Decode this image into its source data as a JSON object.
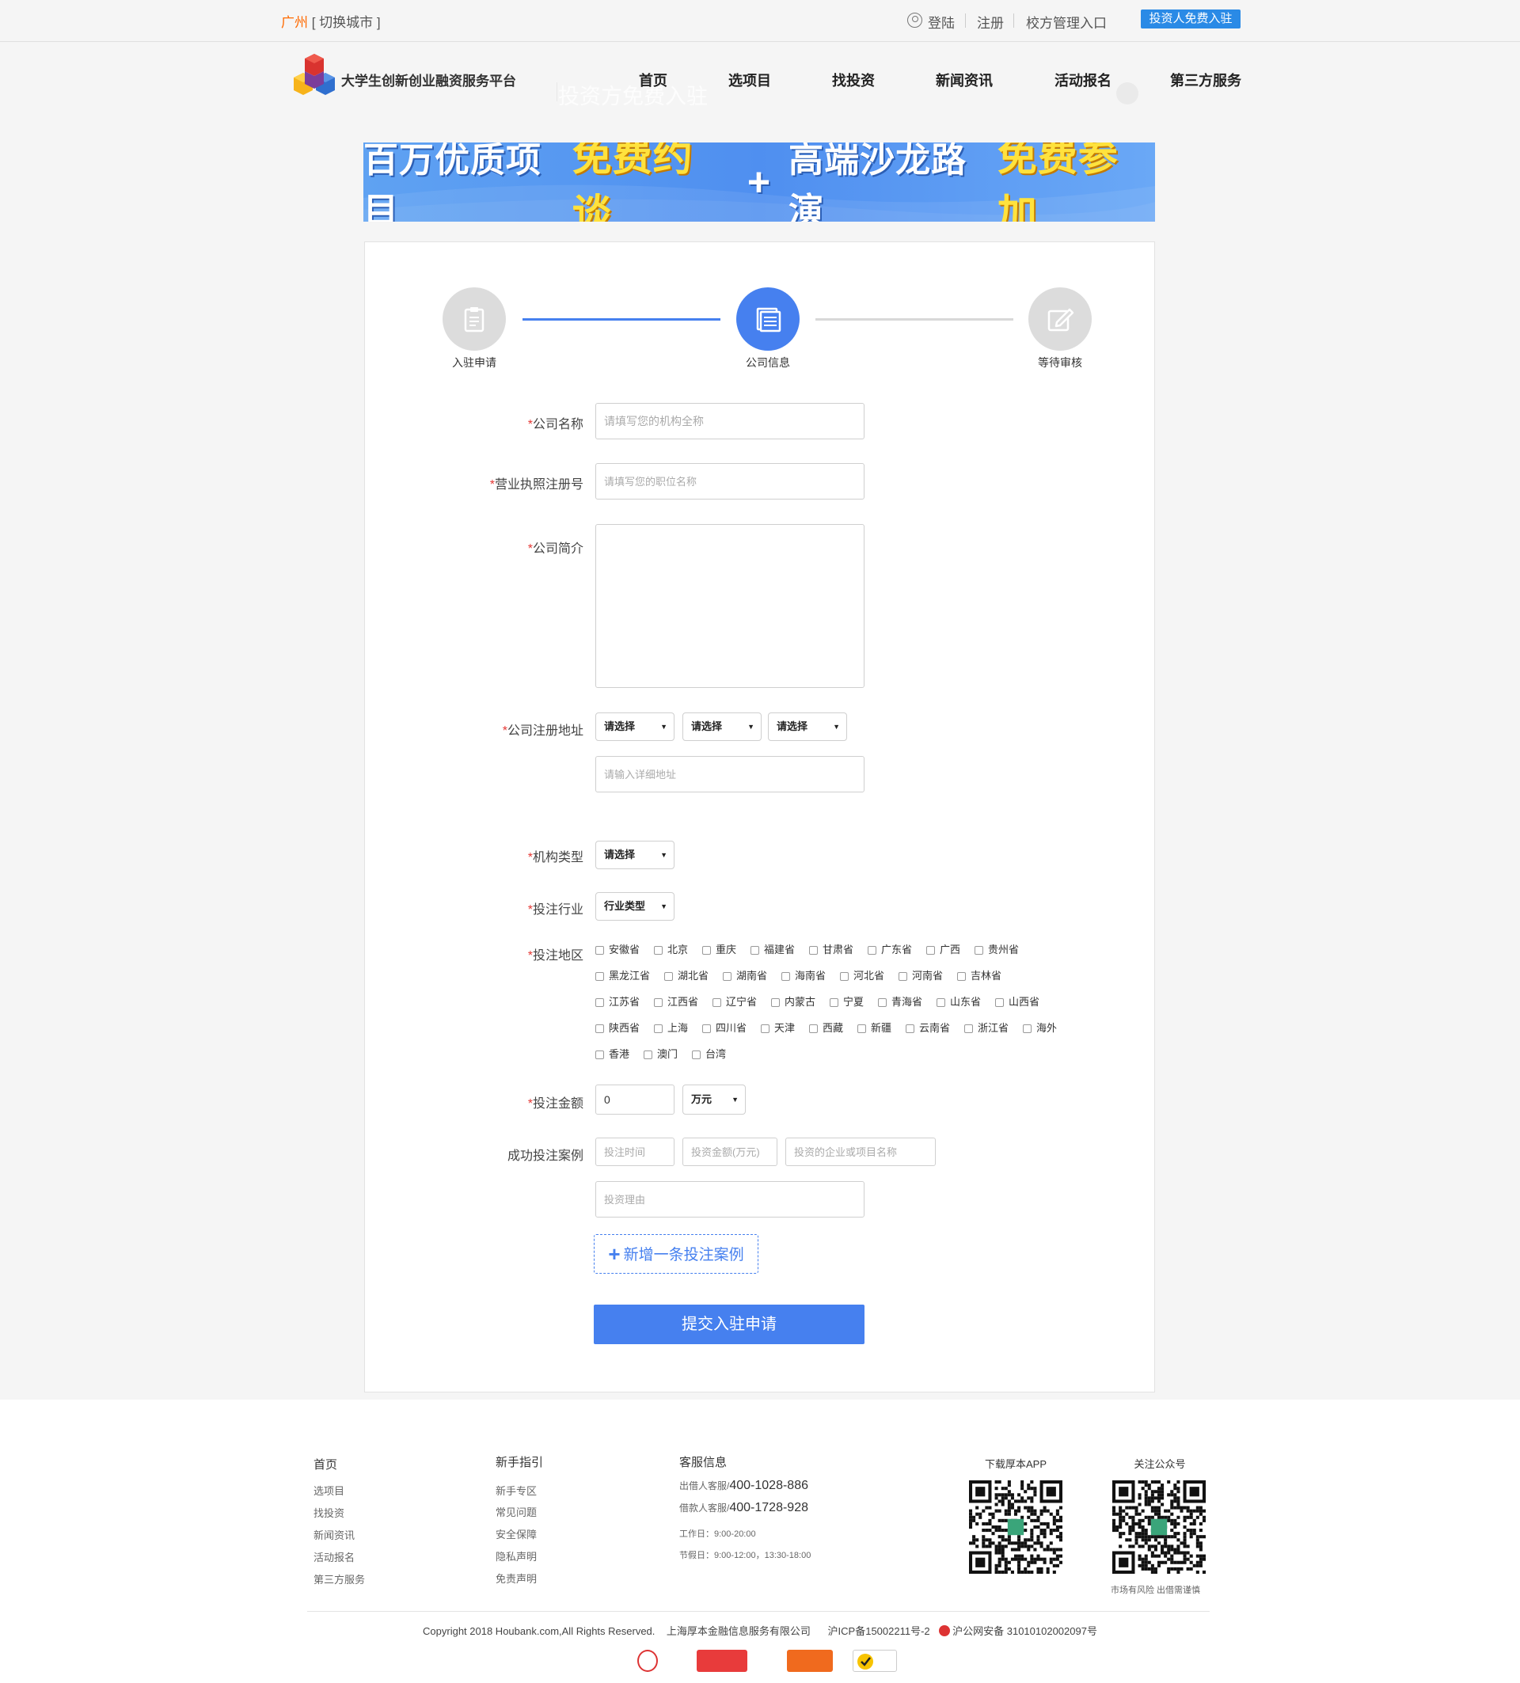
{
  "topbar": {
    "city": "广州",
    "switch_city": "[ 切换城市 ]",
    "login": "登陆",
    "register": "注册",
    "school_admin": "校方管理入口",
    "investor_join": "投资人免费入驻"
  },
  "header": {
    "brand": "大学生创新创业融资服务平台",
    "ghost_text": "投资方免费入驻",
    "nav": [
      "首页",
      "选项目",
      "找投资",
      "新闻资讯",
      "活动报名",
      "第三方服务"
    ]
  },
  "banner": {
    "part1": "百万优质项目",
    "part2": "免费约谈",
    "plus": "+",
    "part3": "高端沙龙路演",
    "part4": "免费参加"
  },
  "steps": [
    {
      "label": "入驻申请",
      "icon": "clipboard-icon"
    },
    {
      "label": "公司信息",
      "icon": "document-list-icon"
    },
    {
      "label": "等待审核",
      "icon": "edit-icon"
    }
  ],
  "form": {
    "required_mark": "*",
    "company_name": {
      "label": "公司名称",
      "placeholder": "请填写您的机构全称"
    },
    "license": {
      "label": "营业执照注册号",
      "placeholder": "请填写您的职位名称"
    },
    "intro": {
      "label": "公司简介"
    },
    "address": {
      "label": "公司注册地址",
      "select1": "请选择",
      "select2": "请选择",
      "select3": "请选择",
      "placeholder": "请输入详细地址"
    },
    "org_type": {
      "label": "机构类型",
      "value": "请选择"
    },
    "industry": {
      "label": "投注行业",
      "value": "行业类型"
    },
    "region": {
      "label": "投注地区",
      "options": [
        [
          "安徽省",
          "北京",
          "重庆",
          "福建省",
          "甘肃省",
          "广东省",
          "广西",
          "贵州省"
        ],
        [
          "黑龙江省",
          "湖北省",
          "湖南省",
          "海南省",
          "河北省",
          "河南省",
          "吉林省"
        ],
        [
          "江苏省",
          "江西省",
          "辽宁省",
          "内蒙古",
          "宁夏",
          "青海省",
          "山东省",
          "山西省"
        ],
        [
          "陕西省",
          "上海",
          "四川省",
          "天津",
          "西藏",
          "新疆",
          "云南省",
          "浙江省",
          "海外"
        ],
        [
          "香港",
          "澳门",
          "台湾"
        ]
      ]
    },
    "amount": {
      "label": "投注金额",
      "value": "0",
      "unit": "万元"
    },
    "cases": {
      "label": "成功投注案例",
      "time_placeholder": "投注时间",
      "amount_placeholder": "投资金额(万元)",
      "name_placeholder": "投资的企业或项目名称",
      "reason_placeholder": "投资理由"
    },
    "add_case": "新增一条投注案例",
    "submit": "提交入驻申请"
  },
  "footer": {
    "col1": {
      "title": "首页",
      "items": [
        "选项目",
        "找投资",
        "新闻资讯",
        "活动报名",
        "第三方服务"
      ]
    },
    "col2": {
      "title": "新手指引",
      "items": [
        "新手专区",
        "常见问题",
        "安全保障",
        "隐私声明",
        "免责声明"
      ]
    },
    "service": {
      "title": "客服信息",
      "lender_label": "出借人客服/",
      "lender_tel": "400-1028-886",
      "borrower_label": "借款人客服/",
      "borrower_tel": "400-1728-928",
      "workday": "工作日：9:00-20:00",
      "holiday": "节假日：9:00-12:00，13:30-18:00"
    },
    "app_title": "下载厚本APP",
    "wechat_title": "关注公众号",
    "risk": "市场有风险 出借需谨慎",
    "copyright": "Copyright 2018 Houbank.com,All Rights Reserved.",
    "company": "上海厚本金融信息服务有限公司",
    "icp": "沪ICP备15002211号-2",
    "police": "沪公网安备 31010102002097号"
  },
  "colors": {
    "primary": "#4680ef",
    "accent_orange": "#ff6a00",
    "topbar_button": "#2a8ae6",
    "required": "#e53935"
  }
}
